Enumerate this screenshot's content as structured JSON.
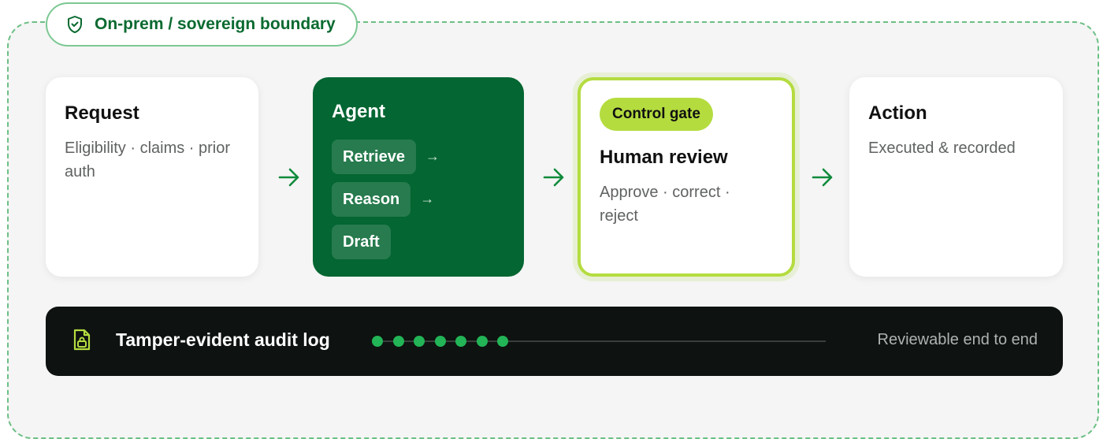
{
  "boundary": {
    "label": "On-prem / sovereign boundary",
    "icon": "shield-check-icon"
  },
  "flow": {
    "request": {
      "title": "Request",
      "description": "Eligibility · claims · prior auth"
    },
    "agent": {
      "title": "Agent",
      "steps": [
        "Retrieve",
        "Reason",
        "Draft"
      ]
    },
    "review": {
      "badge": "Control gate",
      "title": "Human review",
      "description": "Approve · correct · reject"
    },
    "action": {
      "title": "Action",
      "description": "Executed & recorded"
    },
    "arrow_icon": "arrow-right-icon"
  },
  "audit": {
    "label": "Tamper-evident audit log",
    "icon": "file-lock-icon",
    "status": "Reviewable end to end",
    "entries_logged": 7
  },
  "colors": {
    "brand_green": "#046632",
    "accent_lime": "#b4dc3f",
    "dashed_border": "#6cbf85",
    "audit_dot": "#22b456",
    "audit_bg": "#0e1210"
  }
}
